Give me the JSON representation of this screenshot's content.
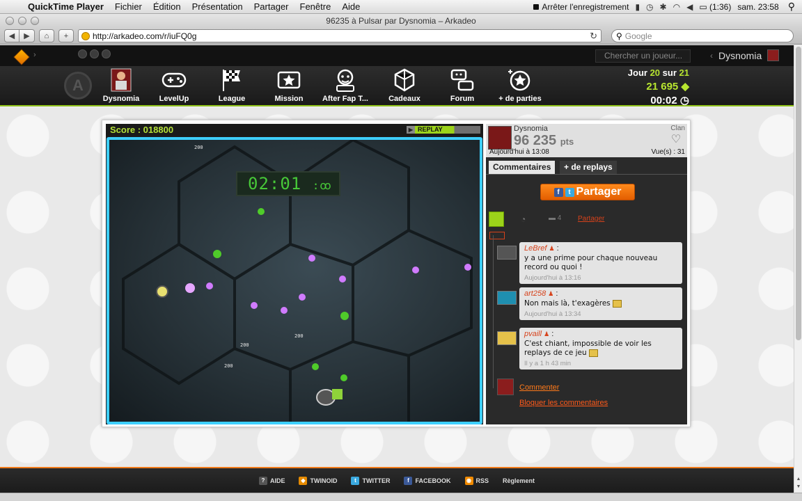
{
  "menubar": {
    "app_name": "QuickTime Player",
    "items": [
      "Fichier",
      "Édition",
      "Présentation",
      "Partager",
      "Fenêtre",
      "Aide"
    ],
    "record_label": "Arrêter l'enregistrement",
    "battery": "(1:36)",
    "clock": "sam. 23:58"
  },
  "window": {
    "title": "96235 à Pulsar par Dysnomia – Arkadeo"
  },
  "browser": {
    "url": "http://arkadeo.com/r/iuFQ0g",
    "search_placeholder": "Google"
  },
  "site_header": {
    "player_search_placeholder": "Chercher un joueur...",
    "username": "Dysnomia",
    "nav": [
      {
        "label": "Dysnomia",
        "icon": "avatar-icon"
      },
      {
        "label": "LevelUp",
        "icon": "gamepad-icon"
      },
      {
        "label": "League",
        "icon": "checkered-flag-icon"
      },
      {
        "label": "Mission",
        "icon": "star-ticket-icon"
      },
      {
        "label": "After Fap T...",
        "icon": "monkey-icon"
      },
      {
        "label": "Cadeaux",
        "icon": "gift-icon"
      },
      {
        "label": "Forum",
        "icon": "chat-icon"
      },
      {
        "label": "+ de parties",
        "icon": "star-badge-icon"
      }
    ],
    "day_prefix": "Jour",
    "day_current": "20",
    "day_sep": "sur",
    "day_total": "21",
    "points": "21 695",
    "time": "00:02"
  },
  "game": {
    "score_label": "Score : 018800",
    "replay_label": "REPLAY",
    "timer": "02:01",
    "point_labels": [
      "200",
      "200",
      "200",
      "200"
    ]
  },
  "side": {
    "player_name": "Dysnomia",
    "points": "96 235",
    "points_unit": "pts",
    "clan_label": "Clan",
    "date": "Aujourd'hui à 13:08",
    "views": "Vue(s) : 31",
    "tabs": [
      "Commentaires",
      "+ de replays"
    ],
    "share_label": "Partager",
    "comment_count": "4",
    "share_link": "Partager",
    "comments": [
      {
        "author": "LeBref",
        "text": "y a une prime pour chaque nouveau record ou quoi !",
        "time": "Aujourd'hui à 13:16"
      },
      {
        "author": "art258",
        "text": "Non mais là, t'exagères",
        "time": "Aujourd'hui à 13:34"
      },
      {
        "author": "pvaill",
        "text": "C'est chiant, impossible de voir les replays de ce jeu",
        "time": "Il y a 1 h 43 min"
      }
    ],
    "comment_link": "Commenter",
    "block_link": "Bloquer les commentaires"
  },
  "footer": {
    "links": [
      "AIDE",
      "TWINOID",
      "TWITTER",
      "FACEBOOK",
      "RSS",
      "Règlement"
    ]
  },
  "colors": {
    "accent_green": "#b8e630",
    "accent_orange": "#f07a1a",
    "arena_border": "#3ecfff"
  }
}
